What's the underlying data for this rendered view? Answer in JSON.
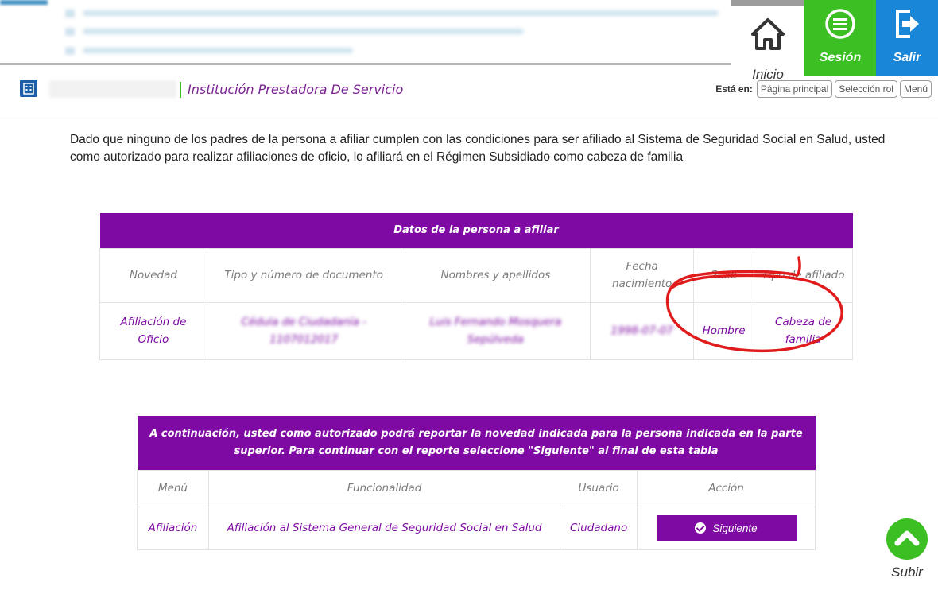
{
  "nav": {
    "inicio": "Inicio",
    "sesion": "Sesión",
    "salir": "Salir"
  },
  "header": {
    "institution": "Institución Prestadora De Servicio",
    "esta_en_label": "Está en:",
    "breadcrumbs": [
      "Página principal",
      "Selección rol",
      "Menú"
    ]
  },
  "intro_text": "Dado que ninguno de los padres de la persona a afiliar cumplen con las condiciones para ser afiliado al Sistema de Seguridad Social en Salud, usted como autorizado para realizar afiliaciones de oficio, lo afiliará en el Régimen Subsidiado como cabeza de familia",
  "persona_table": {
    "title": "Datos de la persona a afiliar",
    "headers": [
      "Novedad",
      "Tipo y número de documento",
      "Nombres y apellidos",
      "Fecha nacimiento",
      "Sexo",
      "Tipo de afiliado"
    ],
    "row": {
      "novedad": "Afiliación de Oficio",
      "documento": "Cédula de Ciudadanía - 1107012017",
      "nombre": "Luis Fernando Mosquera Sepúlveda",
      "fecha": "1998-07-07",
      "sexo": "Hombre",
      "tipo_afiliado": "Cabeza de familia"
    }
  },
  "action_table": {
    "title": "A continuación, usted como autorizado podrá reportar la novedad indicada para la persona indicada en la parte superior. Para continuar con el reporte seleccione \"Siguiente\" al final de esta tabla",
    "headers": [
      "Menú",
      "Funcionalidad",
      "Usuario",
      "Acción"
    ],
    "row": {
      "menu": "Afiliación",
      "funcionalidad": "Afiliación al Sistema General de Seguridad Social en Salud",
      "usuario": "Ciudadano",
      "accion": "Siguiente"
    }
  },
  "subir": "Subir",
  "colors": {
    "brand_purple": "#7e0aa3",
    "green": "#3cbf23",
    "blue": "#1a86d8",
    "annotation_red": "#e01b1b"
  }
}
